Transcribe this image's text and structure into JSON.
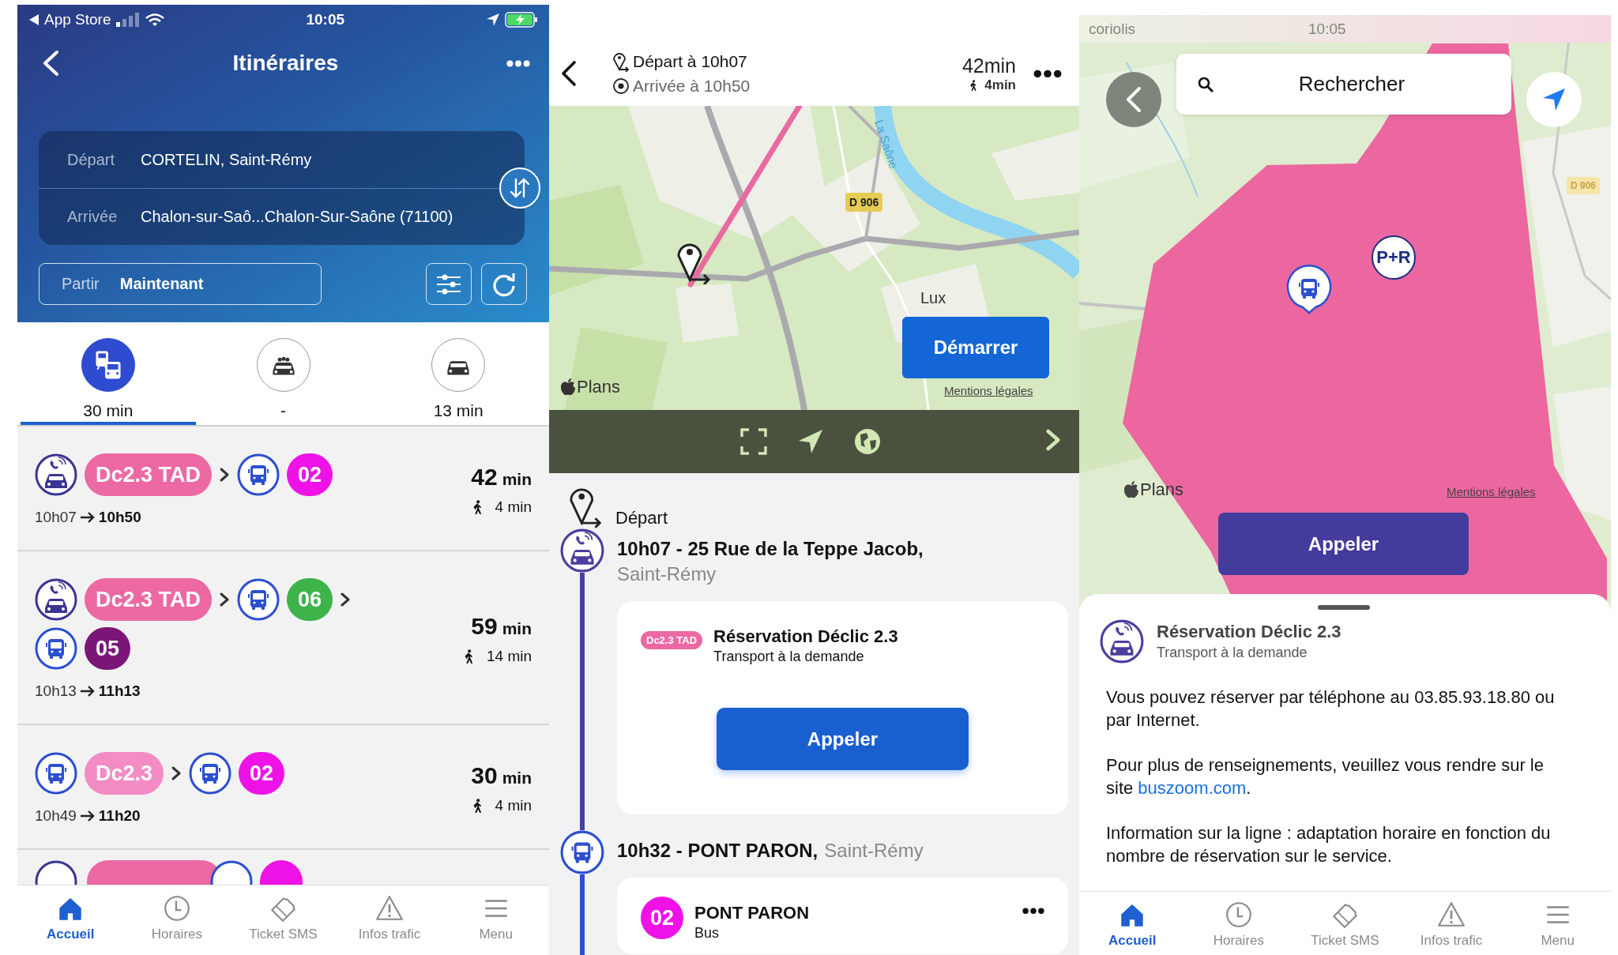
{
  "itineraries": {
    "status_bar": {
      "back_app": "App Store",
      "time": "10:05"
    },
    "header": {
      "title": "Itinéraires"
    },
    "route": {
      "from_label": "Départ",
      "from_value": "CORTELIN, Saint-Rémy",
      "to_label": "Arrivée",
      "to_value": "Chalon-sur-Saô...Chalon-Sur-Saône (71100)"
    },
    "time_field": {
      "label": "Partir",
      "value": "Maintenant"
    },
    "modes": [
      {
        "kind": "transit",
        "label": "30 min",
        "selected": true
      },
      {
        "kind": "carpool",
        "label": "-",
        "selected": false
      },
      {
        "kind": "car",
        "label": "13 min",
        "selected": false
      }
    ],
    "journeys": [
      {
        "legs": [
          {
            "kind": "tad",
            "line": "Dc2.3 TAD",
            "color": "#ec69a3"
          },
          {
            "kind": "bus",
            "line": "02",
            "color": "#ee12e6"
          }
        ],
        "depart": "10h07",
        "arrive": "10h50",
        "duration": "42",
        "duration_unit": "min",
        "walk": "4 min"
      },
      {
        "legs": [
          {
            "kind": "tad",
            "line": "Dc2.3 TAD",
            "color": "#ec69a3"
          },
          {
            "kind": "bus",
            "line": "06",
            "color": "#3db34a"
          },
          {
            "kind": "bus",
            "line": "05",
            "color": "#7b1677"
          }
        ],
        "depart": "10h13",
        "arrive": "11h13",
        "duration": "59",
        "duration_unit": "min",
        "walk": "14 min"
      },
      {
        "legs": [
          {
            "kind": "bus",
            "line": "Dc2.3",
            "color": "#f38bc4"
          },
          {
            "kind": "bus",
            "line": "02",
            "color": "#ee12e6"
          }
        ],
        "depart": "10h49",
        "arrive": "11h20",
        "duration": "30",
        "duration_unit": "min",
        "walk": "4 min"
      }
    ],
    "tab_bar": [
      {
        "kind": "home",
        "label": "Accueil",
        "selected": true
      },
      {
        "kind": "clock",
        "label": "Horaires",
        "selected": false
      },
      {
        "kind": "ticket",
        "label": "Ticket SMS",
        "selected": false
      },
      {
        "kind": "warning",
        "label": "Infos trafic",
        "selected": false
      },
      {
        "kind": "menu",
        "label": "Menu",
        "selected": false
      }
    ]
  },
  "journey_detail": {
    "header": {
      "depart": "Départ à 10h07",
      "arrive": "Arrivée à 10h50",
      "duration": "42min",
      "walk": "4min"
    },
    "map": {
      "river_label": "La Saône",
      "road_label": "D 906",
      "place_label": "Lux",
      "start_button": "Démarrer",
      "attribution": "Plans",
      "legal_link": "Mentions légales"
    },
    "start_label": "Départ",
    "stops": [
      {
        "kind": "tad",
        "time_place": "10h07 - 25 Rue de la Teppe Jacob,",
        "city": "Saint-Rémy",
        "card": {
          "badge": "Dc2.3 TAD",
          "color": "#ec69a3",
          "title": "Réservation Déclic 2.3",
          "subtitle": "Transport à la demande",
          "button": "Appeler"
        }
      },
      {
        "kind": "bus",
        "time_place": "10h32 - PONT PARON,",
        "city": "Saint-Rémy",
        "card": {
          "badge": "02",
          "color": "#ee12e6",
          "title": "PONT PARON",
          "subtitle": "Bus"
        }
      }
    ]
  },
  "zone_map": {
    "status_bar": {
      "carrier": "coriolis",
      "time": "10:05"
    },
    "search": {
      "placeholder": "Rechercher"
    },
    "map": {
      "road_label": "D 906",
      "parking_marker": "P+R",
      "attribution": "Plans",
      "legal_link": "Mentions légales",
      "call_button": "Appeler"
    },
    "sheet": {
      "title": "Réservation Déclic 2.3",
      "subtitle": "Transport à la demande",
      "paragraphs": [
        {
          "text": "Vous pouvez réserver par téléphone au 03.85.93.18.80 ou par Internet."
        },
        {
          "text": "Pour plus de renseignements, veuillez vous rendre sur le site ",
          "link": "buszoom.com",
          "after": "."
        },
        {
          "text": "Information sur la ligne : adaptation horaire en fonction du nombre de réservation sur le service."
        }
      ]
    },
    "tab_bar": [
      {
        "kind": "home",
        "label": "Accueil",
        "selected": true
      },
      {
        "kind": "clock",
        "label": "Horaires",
        "selected": false
      },
      {
        "kind": "ticket",
        "label": "Ticket SMS",
        "selected": false
      },
      {
        "kind": "warning",
        "label": "Infos trafic",
        "selected": false
      },
      {
        "kind": "menu",
        "label": "Menu",
        "selected": false
      }
    ]
  }
}
